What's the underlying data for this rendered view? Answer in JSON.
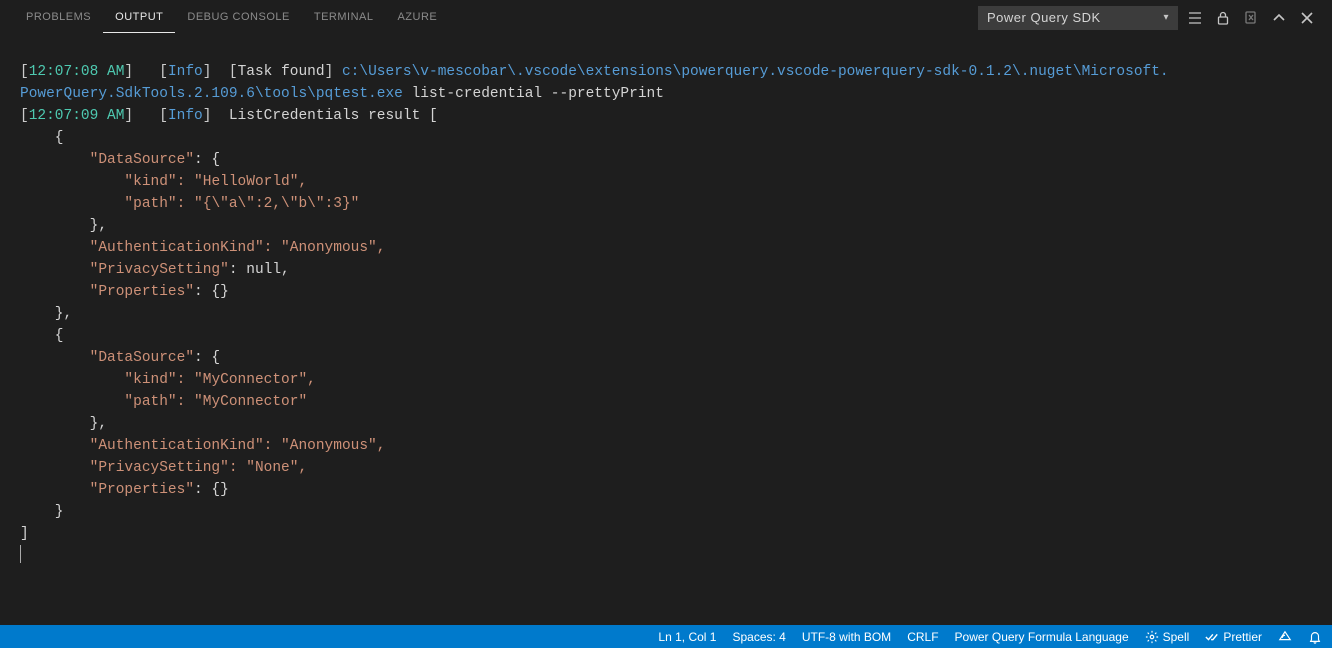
{
  "tabs": {
    "problems": "PROBLEMS",
    "output": "OUTPUT",
    "debug_console": "DEBUG CONSOLE",
    "terminal": "TERMINAL",
    "azure": "AZURE"
  },
  "channel": "Power Query SDK",
  "log1": {
    "timestamp": "12:07:08 AM",
    "level": "Info",
    "task_label": "Task found",
    "path_a": "c:\\Users\\v-mescobar\\.vscode\\extensions\\powerquery.vscode-powerquery-sdk-0.1.2\\.nuget\\Microsoft.",
    "path_b": "PowerQuery.SdkTools.2.109.6\\tools\\pqtest.exe",
    "command": "list-credential --prettyPrint"
  },
  "log2": {
    "timestamp": "12:07:09 AM",
    "level": "Info",
    "msg": "ListCredentials result ["
  },
  "json": {
    "l1": "    {",
    "l2k": "        \"DataSource\"",
    "l2s": ": {",
    "l3k": "            \"kind\"",
    "l3v": ": \"HelloWorld\",",
    "l4k": "            \"path\"",
    "l4v": ": \"{\\\"a\\\":2,\\\"b\\\":3}\"",
    "l5": "        },",
    "l6k": "        \"AuthenticationKind\"",
    "l6v": ": \"Anonymous\",",
    "l7k": "        \"PrivacySetting\"",
    "l7v": ": null,",
    "l8k": "        \"Properties\"",
    "l8v": ": {}",
    "l9": "    },",
    "l10": "    {",
    "l11k": "        \"DataSource\"",
    "l11s": ": {",
    "l12k": "            \"kind\"",
    "l12v": ": \"MyConnector\",",
    "l13k": "            \"path\"",
    "l13v": ": \"MyConnector\"",
    "l14": "        },",
    "l15k": "        \"AuthenticationKind\"",
    "l15v": ": \"Anonymous\",",
    "l16k": "        \"PrivacySetting\"",
    "l16v": ": \"None\",",
    "l17k": "        \"Properties\"",
    "l17v": ": {}",
    "l18": "    }",
    "l19": "]"
  },
  "status": {
    "ln": "Ln 1, Col 1",
    "spaces": "Spaces: 4",
    "encoding": "UTF-8 with BOM",
    "eol": "CRLF",
    "lang": "Power Query Formula Language",
    "spell": "Spell",
    "prettier": "Prettier"
  }
}
